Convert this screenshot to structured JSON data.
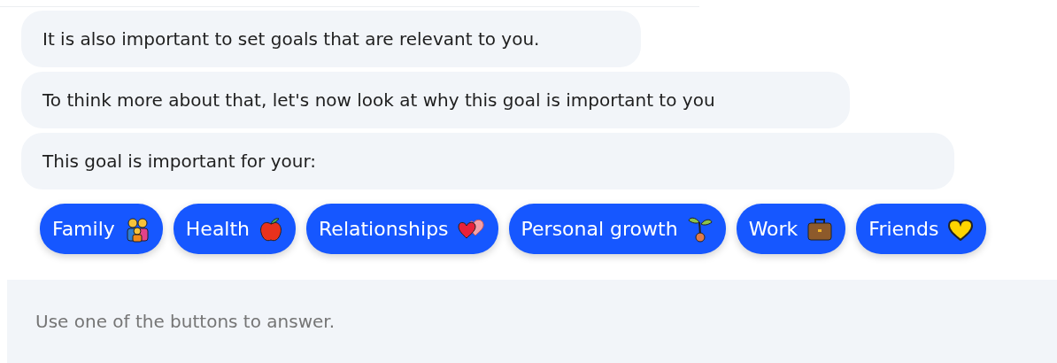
{
  "messages": [
    {
      "text": "It is also important to set goals that are relevant to you."
    },
    {
      "text": "To think more about that, let's now look at why this goal is important to you"
    },
    {
      "text": "This goal is important for your:"
    }
  ],
  "options": [
    {
      "label": "Family"
    },
    {
      "label": "Health"
    },
    {
      "label": "Relationships"
    },
    {
      "label": "Personal growth"
    },
    {
      "label": "Work"
    },
    {
      "label": "Friends"
    }
  ],
  "composer": {
    "placeholder": "Use one of the buttons to answer."
  }
}
